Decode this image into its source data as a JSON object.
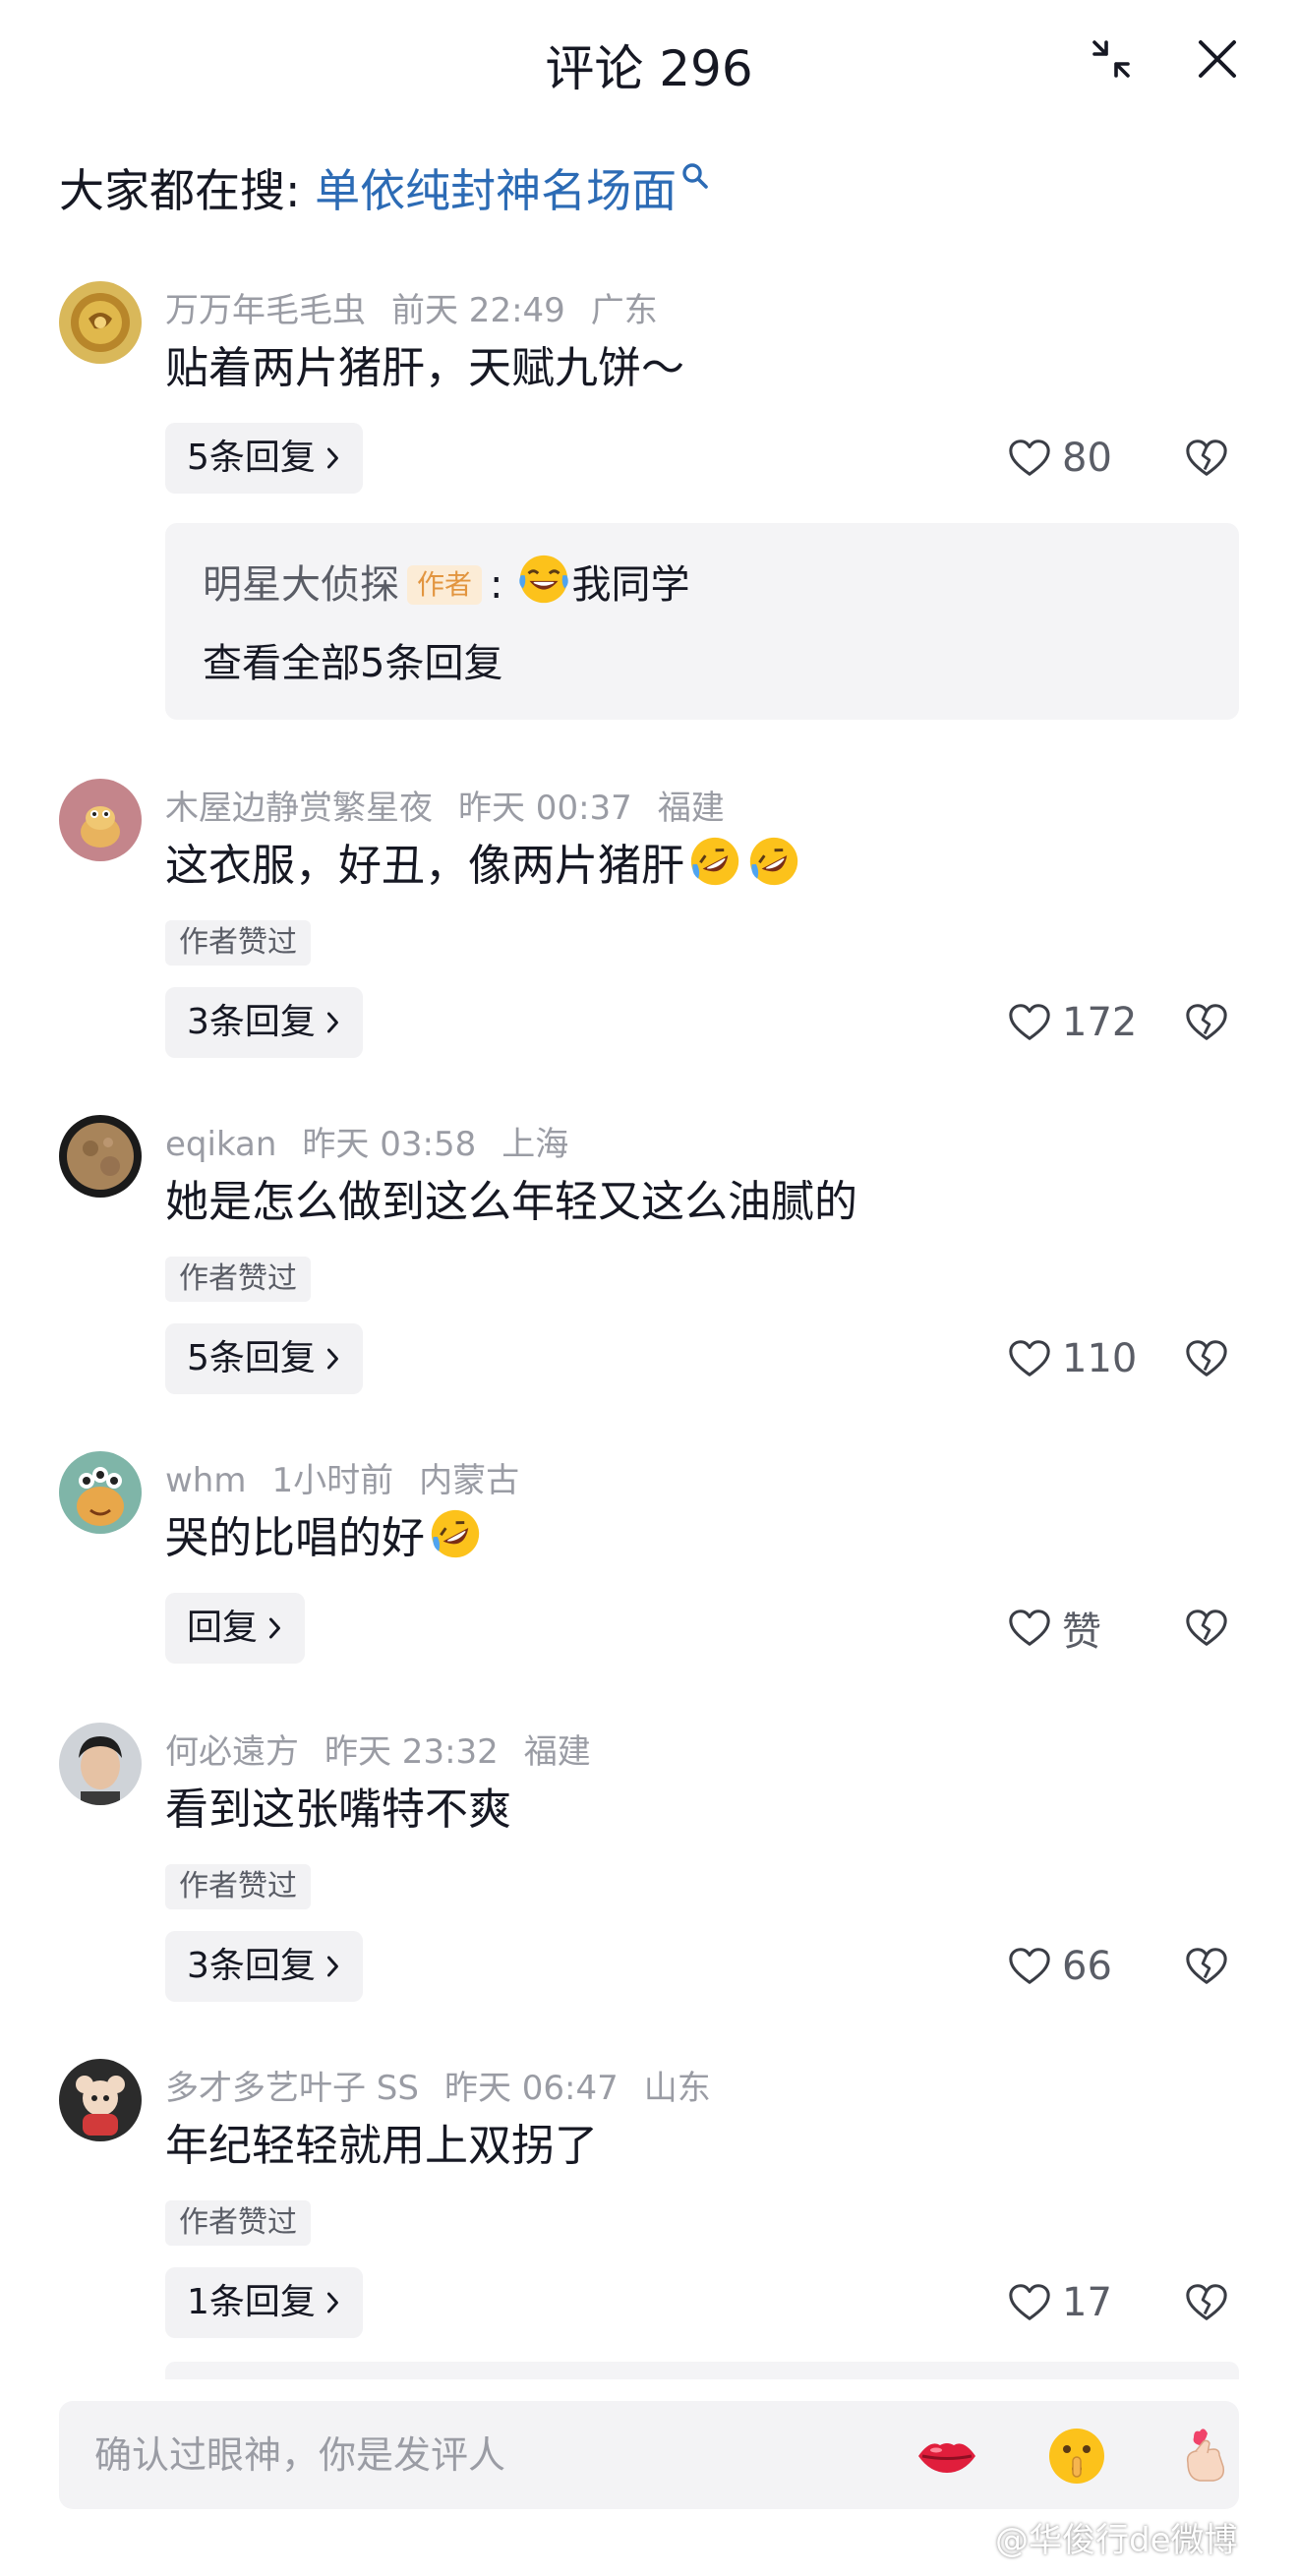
{
  "header": {
    "title": "评论 296"
  },
  "trending": {
    "label": "大家都在搜: ",
    "keyword": "单依纯封神名场面"
  },
  "comments": [
    {
      "username": "万万年毛毛虫",
      "time": "前天 22:49",
      "location": "广东",
      "text": "贴着两片猪肝，天赋九饼～",
      "reply_label": "5条回复",
      "likes": "80",
      "sub_reply": {
        "author": "明星大侦探",
        "badge": "作者",
        "colon": ":",
        "text": "我同学",
        "view_all": "查看全部5条回复"
      }
    },
    {
      "username": "木屋边静赏繁星夜",
      "time": "昨天 00:37",
      "location": "福建",
      "text": "这衣服，好丑，像两片猪肝",
      "liked_by_author": "作者赞过",
      "reply_label": "3条回复",
      "likes": "172"
    },
    {
      "username": "eqikan",
      "time": "昨天 03:58",
      "location": "上海",
      "text": "她是怎么做到这么年轻又这么油腻的",
      "liked_by_author": "作者赞过",
      "reply_label": "5条回复",
      "likes": "110"
    },
    {
      "username": "whm",
      "time": "1小时前",
      "location": "内蒙古",
      "text": "哭的比唱的好",
      "reply_label": "回复",
      "likes": "赞"
    },
    {
      "username": "何必遠方",
      "time": "昨天 23:32",
      "location": "福建",
      "text": "看到这张嘴特不爽",
      "liked_by_author": "作者赞过",
      "reply_label": "3条回复",
      "likes": "66"
    },
    {
      "username": "多才多艺叶子 SS",
      "time": "昨天 06:47",
      "location": "山东",
      "text": "年纪轻轻就用上双拐了",
      "liked_by_author": "作者赞过",
      "reply_label": "1条回复",
      "likes": "17"
    }
  ],
  "input": {
    "placeholder": "确认过眼神，你是发评人"
  },
  "watermark": "@华俊行de微博",
  "icons": {
    "header": [
      "collapse-icon",
      "close-icon"
    ],
    "actions": [
      "heart-icon",
      "broken-heart-icon",
      "chevron-right-icon"
    ],
    "quick_emojis": [
      "lips-emoji",
      "shush-emoji",
      "finger-heart-emoji"
    ]
  },
  "colors": {
    "link": "#2c6bb5",
    "secondary_text": "#9a9ca4",
    "author_badge": "#e2953f",
    "chip_bg": "#f2f2f4"
  }
}
